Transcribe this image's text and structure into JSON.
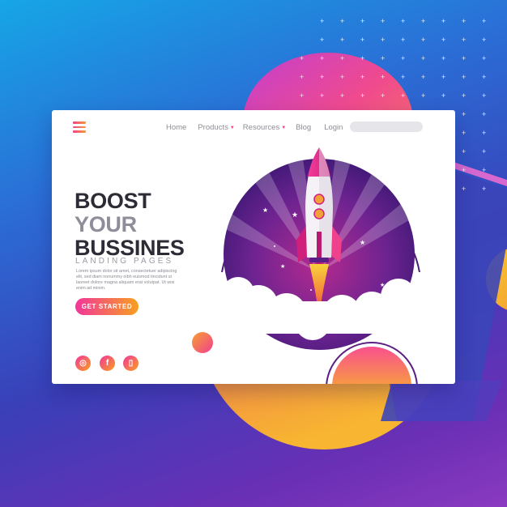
{
  "nav": {
    "items": [
      {
        "label": "Home",
        "dropdown": false
      },
      {
        "label": "Products",
        "dropdown": true
      },
      {
        "label": "Resources",
        "dropdown": true
      },
      {
        "label": "Blog",
        "dropdown": false
      },
      {
        "label": "Login",
        "dropdown": false
      }
    ],
    "caret_symbol": "▼"
  },
  "hero": {
    "headline_line1": "BOOST",
    "headline_line2": "YOUR",
    "headline_line3": "BUSSINES",
    "subtitle": "LANDING PAGES",
    "body": "Lorem ipsum dolor sit amet, consectetuer adipiscing elit, sed diam nonummy nibh euismod tincidunt ut laoreet dolore magna aliquam erat volutpat. Ut wisi enim ad minim.",
    "cta_label": "GET STARTED"
  },
  "social": [
    {
      "name": "instagram-icon",
      "glyph": "◎"
    },
    {
      "name": "facebook-icon",
      "glyph": "f"
    },
    {
      "name": "phone-icon",
      "glyph": "▯"
    }
  ],
  "colors": {
    "accent_pink": "#f2369a",
    "accent_orange": "#f7a020",
    "headline_dark": "#2d2c36",
    "headline_gray": "#8e8d99",
    "hero_purple": "#4a1a7a"
  }
}
